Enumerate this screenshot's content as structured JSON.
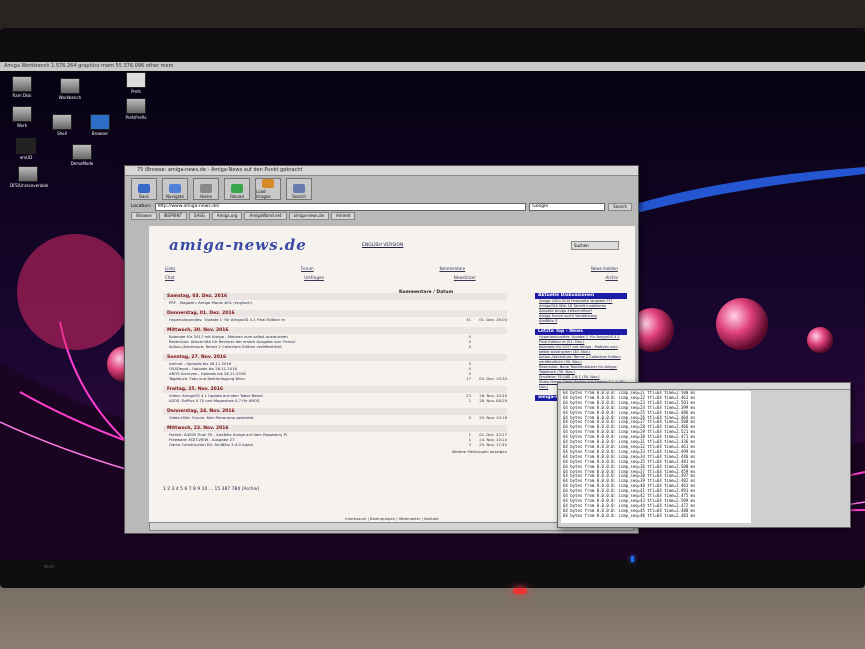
{
  "screen": {
    "title_bar": "Amiga Workbench    1.576.264 graphics mem    55.376.096 other mem",
    "desktop_icons": [
      "Ram Disk",
      "Work",
      "Workbench",
      "Prefs",
      "PrefsPrefix",
      "Shell",
      "Browser",
      "emUD",
      "DemoMode",
      "DFS/Unrecoverable"
    ]
  },
  "browser": {
    "window_title": "75 iBrowse: amiga-news.de - Amiga-News auf den Punkt gebracht",
    "toolbar": [
      "Back",
      "Navigate",
      "Home",
      "Reload",
      "Load Images",
      "Search"
    ],
    "location_label": "Location:",
    "location_value": "http://www.amiga-news.de/",
    "google_label": "Google",
    "search_button": "Search",
    "bookmarks": [
      "iBrowse",
      "IBSPRINT",
      "SASG",
      "Amiga.org",
      "AmigaWorld.net",
      "amiga-news.de",
      "Aminet"
    ],
    "page": {
      "logo": "amiga-news.de",
      "english_link": "ENGLISH VERSION",
      "search_box": "Suchen",
      "nav_row1": [
        "Links",
        "Forum",
        "Kommentare",
        "News melden"
      ],
      "nav_row2": [
        "Chat",
        "Umfragen",
        "Newsticker",
        "Archiv"
      ],
      "comments_header": "Kommentare / Datum",
      "days": [
        {
          "label": "Samstag, 03. Dez. 2016",
          "items": [
            {
              "title": "PRF - Magazin: Amiga Mania #01 (englisch)",
              "count": "",
              "date": ""
            }
          ]
        },
        {
          "label": "Donnerstag, 01. Dez. 2016",
          "items": [
            {
              "title": "Hyperionbundles: 'Update 1' für AmigaOS 4.1 Final Edition re",
              "count": "31",
              "date": "01. Dez. 16:00"
            }
          ]
        },
        {
          "label": "Mittwoch, 30. Nov. 2016",
          "items": [
            {
              "title": "Kalender für 2017 mit Amiga - Motiven zum selbst ausdrucken",
              "count": "0",
              "date": ""
            },
            {
              "title": "Rezension: Abschnitte für Rechner der ersten Ausgabe von 'Fenna'",
              "count": "0",
              "date": ""
            },
            {
              "title": "Action-/Adventure: Remiz 2 Collectors Edition veröffentlicht",
              "count": "0",
              "date": ""
            }
          ]
        },
        {
          "label": "Sonntag, 27. Nov. 2016",
          "items": [
            {
              "title": "Aminet - Uploads bis 26.11.2016",
              "count": "0",
              "date": ""
            },
            {
              "title": "OS4Depot - Uploads bis 26.11.2016",
              "count": "0",
              "date": ""
            },
            {
              "title": "AROS Archives - Uploads bis 26.11.2016",
              "count": "0",
              "date": ""
            },
            {
              "title": "Tagebuch: Foto und Bastlertagung Wien",
              "count": "17",
              "date": "03. Dez. 10:30"
            }
          ]
        },
        {
          "label": "Freitag, 25. Nov. 2016",
          "items": [
            {
              "title": "Video: AmigaOS 4.1 Update auf dem Tabor Board",
              "count": "23",
              "date": "28. Nov. 10:29"
            },
            {
              "title": "ASOS: EdPlus 0.75 und Magazines 0.7 für AROS",
              "count": "1",
              "date": "28. Nov. 08:29"
            }
          ]
        },
        {
          "label": "Donnerstag, 24. Nov. 2016",
          "items": [
            {
              "title": "Video-Hilfe: Forum: Kein Panorama gestartet",
              "count": "2",
              "date": "25. Nov. 10:16"
            }
          ]
        },
        {
          "label": "Mittwoch, 23. Nov. 2016",
          "items": [
            {
              "title": "Fotinik: A4000 Final 35 - AmiBlitz Amiga auf dem Raspberry Pi",
              "count": "1",
              "date": "02. Dez. 22:27"
            },
            {
              "title": "Freeware: EDIT-VIEW - Ausgabe 27",
              "count": "1",
              "date": "24. Nov. 10:24"
            },
            {
              "title": "Game Construction Kit: AmiBlitz 3.4.0 Alpha",
              "count": "3",
              "date": "25. Nov. 17:40"
            }
          ]
        }
      ],
      "more_link": "Weitere Meldungen anzeigen",
      "pager": "1 2 3 4 5 6 7 8 9 10 ... 15 387 784 [Archiv]",
      "sidebar": {
        "section1_title": "Aktuelle Diskussionen",
        "section1_items": [
          "Amiga 2000 SCSI Festplatte langsam ???",
          "AmigaOS4 Wiki 18 Tahleft installieren",
          "Aktuelle Amiga Zeitschriften?",
          "Amiga Forum sucht Verstärkung",
          "AmiBlitz 3"
        ],
        "section2_title": "Letzte Top - News",
        "section2_items": [
          "Hyperionbundles 'Update 1' für AmigaOS 4.1 Final Edition re (01. Dez.)",
          "Kalender für 2017 mit Amiga - Motiven zum selbst ausdrucken (30. Nov.)",
          "Action-/Adventure: Remiz 2 Collectors Edition veröffentlicht (30. Nov.)",
          "Rezension: Neue Taschenbücher für Amiga-Tagebuch (30. Nov.)",
          "Emulator: FS-UAE 2.8.1 (30. Nov.)",
          "Video-Demo-Crew: Zocker mit Aminer 2.1.2 (30. Nov.)"
        ],
        "section3_title": "amiga-news.de"
      },
      "footer": "Impressum | Bedingungen | Webmaster | Kontakt"
    }
  },
  "shell": {
    "lines": [
      "64 bytes from 0.0.0.0: icmp_seq=21 ttl=64 time=2.500 ms",
      "64 bytes from 0.0.0.0: icmp_seq=22 ttl=64 time=2.461 ms",
      "64 bytes from 0.0.0.0: icmp_seq=23 ttl=64 time=2.501 ms",
      "64 bytes from 0.0.0.0: icmp_seq=24 ttl=64 time=2.399 ms",
      "64 bytes from 0.0.0.0: icmp_seq=25 ttl=64 time=2.486 ms",
      "64 bytes from 0.0.0.0: icmp_seq=26 ttl=64 time=2.484 ms",
      "64 bytes from 0.0.0.0: icmp_seq=27 ttl=64 time=2.500 ms",
      "64 bytes from 0.0.0.0: icmp_seq=28 ttl=64 time=2.466 ms",
      "64 bytes from 0.0.0.0: icmp_seq=29 ttl=64 time=2.521 ms",
      "64 bytes from 0.0.0.0: icmp_seq=30 ttl=64 time=2.471 ms",
      "64 bytes from 0.0.0.0: icmp_seq=31 ttl=64 time=2.436 ms",
      "64 bytes from 0.0.0.0: icmp_seq=32 ttl=64 time=2.461 ms",
      "64 bytes from 0.0.0.0: icmp_seq=33 ttl=64 time=2.499 ms",
      "64 bytes from 0.0.0.0: icmp_seq=34 ttl=64 time=2.446 ms",
      "64 bytes from 0.0.0.0: icmp_seq=35 ttl=64 time=2.481 ms",
      "64 bytes from 0.0.0.0: icmp_seq=36 ttl=64 time=2.500 ms",
      "64 bytes from 0.0.0.0: icmp_seq=37 ttl=64 time=2.459 ms",
      "64 bytes from 0.0.0.0: icmp_seq=38 ttl=64 time=2.497 ms",
      "64 bytes from 0.0.0.0: icmp_seq=39 ttl=64 time=2.482 ms",
      "64 bytes from 0.0.0.0: icmp_seq=40 ttl=64 time=2.463 ms",
      "64 bytes from 0.0.0.0: icmp_seq=41 ttl=64 time=2.491 ms",
      "64 bytes from 0.0.0.0: icmp_seq=42 ttl=64 time=2.475 ms",
      "64 bytes from 0.0.0.0: icmp_seq=43 ttl=64 time=2.509 ms",
      "64 bytes from 0.0.0.0: icmp_seq=44 ttl=64 time=2.472 ms",
      "64 bytes from 0.0.0.0: icmp_seq=45 ttl=64 time=2.488 ms",
      "64 bytes from 0.0.0.0: icmp_seq=46 ttl=64 time=2.483 ms"
    ]
  },
  "monitor": {
    "brand": "eizo"
  },
  "colors": {
    "wallpaper_accent": "#ff3fd0",
    "sidebar_header": "#1c1ca8",
    "day_text": "#7a1010",
    "power_led": "#1e6cff"
  }
}
